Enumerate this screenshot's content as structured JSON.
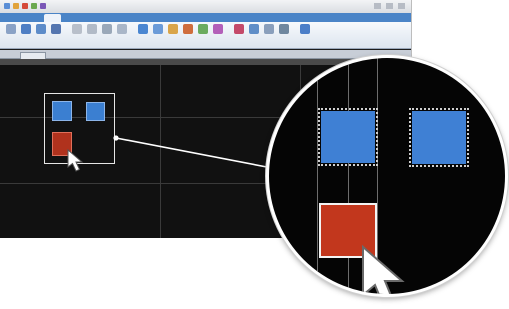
{
  "window": {
    "title": "",
    "quick_access_colors": [
      "#5a8ed6",
      "#e1a33b",
      "#d54a3a",
      "#6aa84f",
      "#7a57b7"
    ]
  },
  "ribbon_tabs": [
    {
      "label": "",
      "active": false
    },
    {
      "label": "",
      "active": false
    },
    {
      "label": "",
      "active": true
    },
    {
      "label": "",
      "active": false
    },
    {
      "label": "",
      "active": false
    },
    {
      "label": "",
      "active": false
    },
    {
      "label": "",
      "active": false
    },
    {
      "label": "",
      "active": false
    }
  ],
  "ribbon_buttons": [
    {
      "icon": "select-icon",
      "color": "#8aa2c6"
    },
    {
      "icon": "group-icon",
      "color": "#4f7fc4"
    },
    {
      "icon": "align-icon",
      "color": "#5d8cc9"
    },
    {
      "icon": "arrange-icon",
      "color": "#5576b0"
    },
    {
      "icon": "cut-icon",
      "color": "#b8bfca"
    },
    {
      "icon": "copy-icon",
      "color": "#b1bac7"
    },
    {
      "icon": "paste-icon",
      "color": "#9aa8b9"
    },
    {
      "icon": "rotate-icon",
      "color": "#a9b6c8"
    },
    {
      "icon": "shape-icon",
      "color": "#4a86d1"
    },
    {
      "icon": "color-icon",
      "color": "#6b9bd8"
    },
    {
      "icon": "pen-icon",
      "color": "#d9a54a"
    },
    {
      "icon": "brush-icon",
      "color": "#cf6d3d"
    },
    {
      "icon": "fill-icon",
      "color": "#6bab5f"
    },
    {
      "icon": "effects-icon",
      "color": "#b35fb9"
    },
    {
      "icon": "heart-icon",
      "color": "#c44a6a"
    },
    {
      "icon": "view-icon",
      "color": "#5f8ec8"
    },
    {
      "icon": "zoom-icon",
      "color": "#8a9fbc"
    },
    {
      "icon": "shadow-icon",
      "color": "#6f879f"
    },
    {
      "icon": "settings-icon",
      "color": "#4b7ec8"
    }
  ],
  "document_tab": {
    "label": ""
  },
  "colors": {
    "canvas": "#111111",
    "blue_shape": "#3b7fd1",
    "red_shape": "#b0321d",
    "selection": "#e6e6e6"
  }
}
